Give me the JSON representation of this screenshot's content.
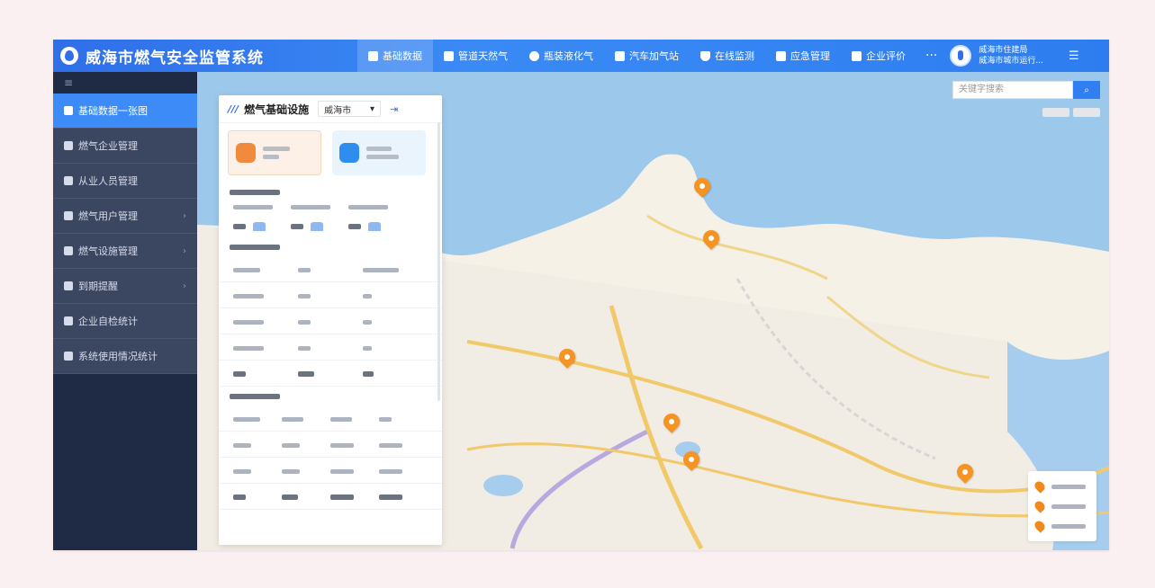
{
  "header": {
    "app_title": "威海市燃气安全监管系统",
    "nav": [
      {
        "label": "基础数据",
        "active": true
      },
      {
        "label": "管道天然气"
      },
      {
        "label": "瓶装液化气"
      },
      {
        "label": "汽车加气站"
      },
      {
        "label": "在线监测"
      },
      {
        "label": "应急管理"
      },
      {
        "label": "企业评价"
      }
    ],
    "more": "···",
    "user_line1": "威海市住建局",
    "user_line2": "威海市城市运行..."
  },
  "sidebar": {
    "collapse_icon": "≡",
    "items": [
      {
        "label": "基础数据一张图",
        "active": true
      },
      {
        "label": "燃气企业管理"
      },
      {
        "label": "从业人员管理"
      },
      {
        "label": "燃气用户管理",
        "has_children": true
      },
      {
        "label": "燃气设施管理",
        "has_children": true
      },
      {
        "label": "到期提醒",
        "has_children": true
      },
      {
        "label": "企业自检统计"
      },
      {
        "label": "系统使用情况统计"
      }
    ]
  },
  "panel": {
    "title": "燃气基础设施",
    "city_value": "威海市"
  },
  "search": {
    "placeholder": "关键字搜索"
  },
  "colors": {
    "primary": "#2f7ff1",
    "sidebar_bg": "#1f2b45",
    "marker": "#f59423"
  }
}
